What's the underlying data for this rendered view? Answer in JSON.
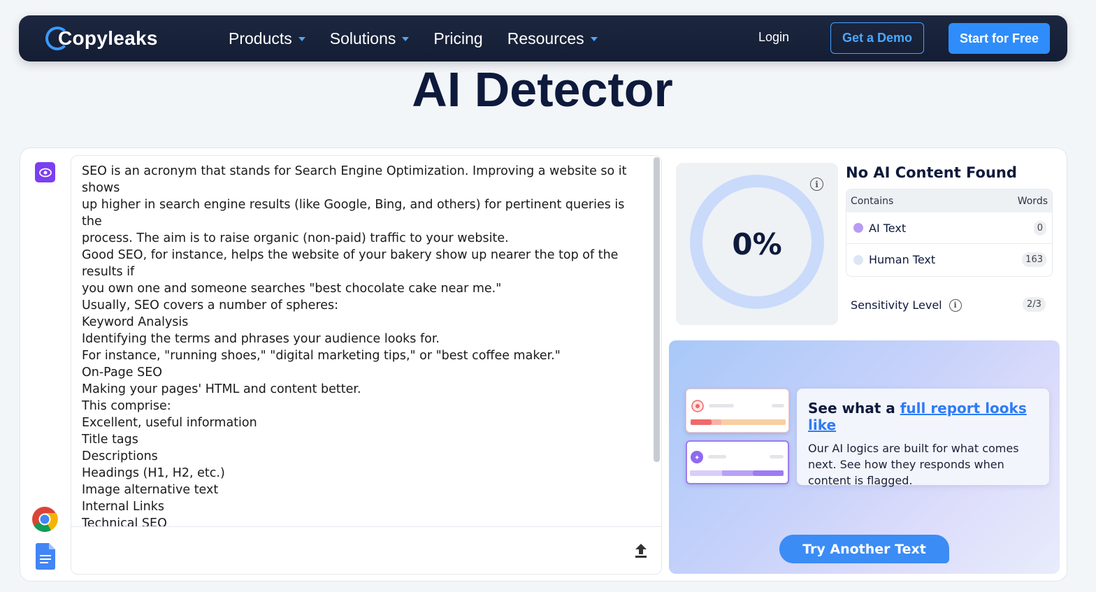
{
  "nav": {
    "brand": "Copyleaks",
    "items": [
      {
        "label": "Products",
        "dropdown": true
      },
      {
        "label": "Solutions",
        "dropdown": true
      },
      {
        "label": "Pricing",
        "dropdown": false
      },
      {
        "label": "Resources",
        "dropdown": true
      }
    ],
    "login": "Login",
    "demo": "Get a Demo",
    "start": "Start for Free"
  },
  "page_title": "AI Detector",
  "editor": {
    "text": "SEO is an acronym that stands for Search Engine Optimization. Improving a website so it shows\nup higher in search engine results (like Google, Bing, and others) for pertinent queries is the\nprocess. The aim is to raise organic (non-paid) traffic to your website.\nGood SEO, for instance, helps the website of your bakery show up nearer the top of the results if\nyou own one and someone searches \"best chocolate cake near me.\"\nUsually, SEO covers a number of spheres:\nKeyword Analysis\nIdentifying the terms and phrases your audience looks for.\nFor instance, \"running shoes,\" \"digital marketing tips,\" or \"best coffee maker.\"\nOn-Page SEO\nMaking your pages' HTML and content better.\nThis comprise:\nExcellent, useful information\nTitle tags\nDescriptions\nHeadings (H1, H2, etc.)\nImage alternative text\nInternal Links\nTechnical SEO\nMaking sure search engines can find and index your website without any trouble.\nFeatures comprises:\nQuick loading time"
  },
  "result": {
    "percent": "0%",
    "percent_value": 0,
    "title": "No AI Content Found",
    "table_head": {
      "contains": "Contains",
      "words": "Words"
    },
    "rows": [
      {
        "label": "AI Text",
        "count": "0",
        "color": "#b79cf0"
      },
      {
        "label": "Human Text",
        "count": "163",
        "color": "#dde6f5"
      }
    ],
    "sensitivity_label": "Sensitivity Level",
    "sensitivity_value": "2/3"
  },
  "promo": {
    "heading_prefix": "See what a ",
    "heading_link": "full report looks like",
    "body": "Our AI logics are built for what comes next. See how they responds when content is flagged.",
    "try_button": "Try Another Text"
  },
  "colors": {
    "accent": "#2e8dfb",
    "nav_bg": "#1c2740",
    "ai_purple": "#7b3ff2",
    "gauge_ring": "#c9dafb"
  },
  "icons": [
    "eye-icon",
    "chrome-icon",
    "google-docs-icon",
    "upload-icon",
    "info-icon",
    "chevron-down-icon"
  ]
}
